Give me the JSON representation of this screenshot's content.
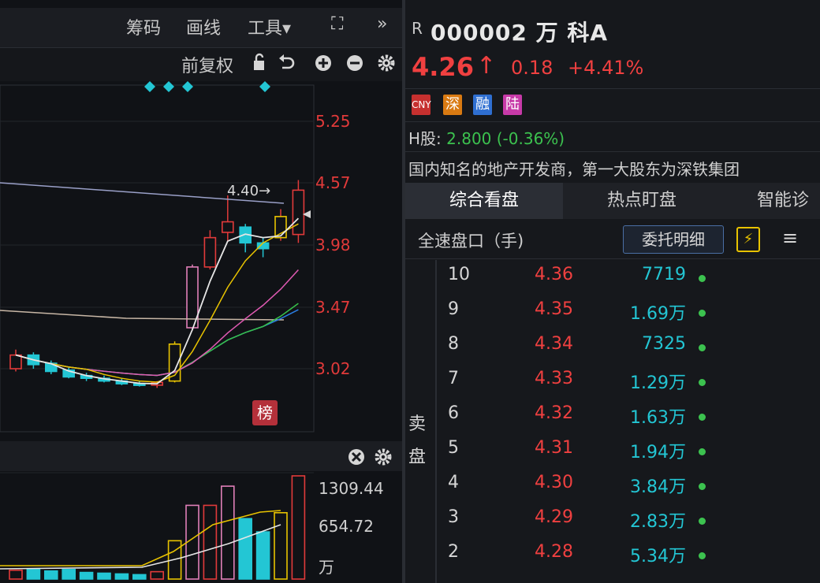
{
  "toolbar": {
    "chips": "筹码",
    "draw": "画线",
    "tools": "工具▾",
    "fullscreen": "⛶",
    "more": "»",
    "adjust": "前复权"
  },
  "chart": {
    "price_levels": [
      "5.25",
      "4.57",
      "3.98",
      "3.47",
      "3.02"
    ],
    "ma_marker": "4.40→",
    "badge": "榜",
    "volume_levels": [
      "1309.44",
      "654.72",
      "万"
    ],
    "candles": [
      {
        "o": 3.02,
        "c": 3.12,
        "h": 3.16,
        "l": 3.0
      },
      {
        "o": 3.12,
        "c": 3.05,
        "h": 3.14,
        "l": 3.02
      },
      {
        "o": 3.06,
        "c": 3.0,
        "h": 3.08,
        "l": 2.98
      },
      {
        "o": 3.01,
        "c": 2.96,
        "h": 3.03,
        "l": 2.95
      },
      {
        "o": 2.97,
        "c": 2.95,
        "h": 2.99,
        "l": 2.93
      },
      {
        "o": 2.95,
        "c": 2.93,
        "h": 2.97,
        "l": 2.92
      },
      {
        "o": 2.93,
        "c": 2.91,
        "h": 2.95,
        "l": 2.9
      },
      {
        "o": 2.91,
        "c": 2.9,
        "h": 2.93,
        "l": 2.89
      },
      {
        "o": 2.9,
        "c": 2.92,
        "h": 2.93,
        "l": 2.88
      },
      {
        "o": 2.93,
        "c": 3.2,
        "h": 3.22,
        "l": 2.92
      },
      {
        "o": 3.32,
        "c": 3.8,
        "h": 3.82,
        "l": 3.3
      },
      {
        "o": 3.8,
        "c": 4.05,
        "h": 4.12,
        "l": 3.78
      },
      {
        "o": 4.1,
        "c": 4.2,
        "h": 4.45,
        "l": 4.02
      },
      {
        "o": 4.15,
        "c": 4.0,
        "h": 4.18,
        "l": 3.92
      },
      {
        "o": 4.0,
        "c": 3.95,
        "h": 4.05,
        "l": 3.88
      },
      {
        "o": 4.05,
        "c": 4.25,
        "h": 4.32,
        "l": 4.02
      },
      {
        "o": 4.08,
        "c": 4.5,
        "h": 4.6,
        "l": 4.0
      }
    ],
    "volumes": [
      120,
      140,
      110,
      130,
      90,
      80,
      70,
      60,
      100,
      520,
      1000,
      1000,
      1260,
      820,
      640,
      900,
      1400
    ]
  },
  "quote": {
    "prefix": "R",
    "code_name": "000002 万 科A",
    "price": "4.26",
    "arrow": "↑",
    "change": "0.18",
    "change_pct": "+4.41%",
    "tags": [
      "CNY",
      "深",
      "融",
      "陆"
    ],
    "h_share_label": "H股:",
    "h_share_value": "2.800 (-0.36%)",
    "description": "国内知名的地产开发商，第一大股东为深铁集团"
  },
  "tabs": [
    "综合看盘",
    "热点盯盘",
    "智能诊"
  ],
  "depth": {
    "title": "全速盘口（手)",
    "detail_button": "委托明细",
    "flash_icon": "⚡",
    "menu_icon": "≡",
    "sell_label_1": "卖",
    "sell_label_2": "盘",
    "rows": [
      {
        "level": "10",
        "price": "4.36",
        "volume": "7719"
      },
      {
        "level": "9",
        "price": "4.35",
        "volume": "1.69万"
      },
      {
        "level": "8",
        "price": "4.34",
        "volume": "7325"
      },
      {
        "level": "7",
        "price": "4.33",
        "volume": "1.29万"
      },
      {
        "level": "6",
        "price": "4.32",
        "volume": "1.63万"
      },
      {
        "level": "5",
        "price": "4.31",
        "volume": "1.94万"
      },
      {
        "level": "4",
        "price": "4.30",
        "volume": "3.84万"
      },
      {
        "level": "3",
        "price": "4.29",
        "volume": "2.83万"
      },
      {
        "level": "2",
        "price": "4.28",
        "volume": "5.34万"
      }
    ]
  },
  "colors": {
    "up": "#e13a3a",
    "down": "#23c6d4",
    "ma_white": "#e6e6e6",
    "ma_yellow": "#e8c300",
    "ma_pink": "#e05ab3",
    "ma_green": "#37c14a",
    "ma_blue": "#2a7de1",
    "ma_long": "#c8b7a6"
  }
}
